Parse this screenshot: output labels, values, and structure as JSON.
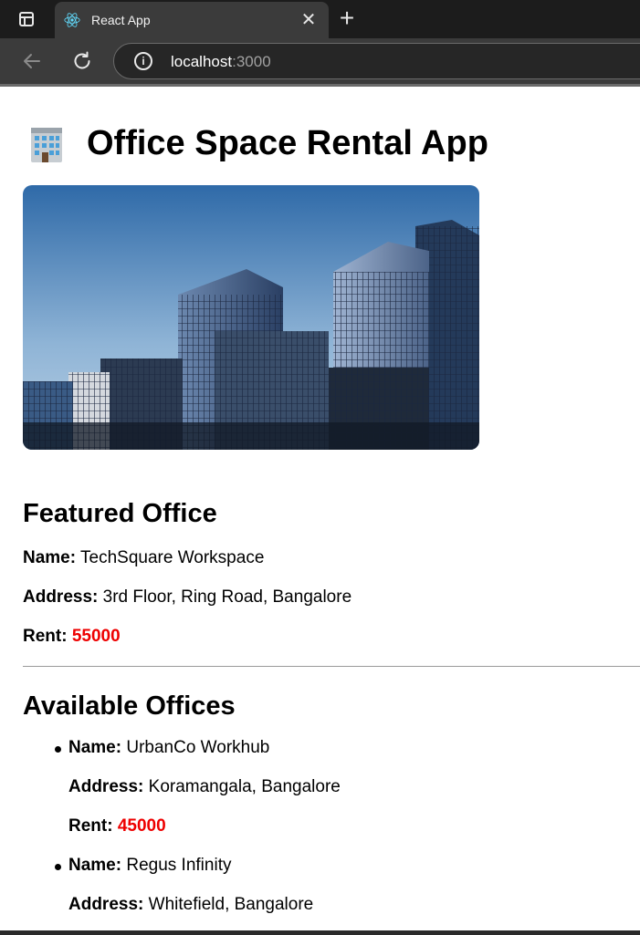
{
  "browser": {
    "tab_title": "React App",
    "tab_close": "✕",
    "new_tab": "+",
    "url_host": "localhost",
    "url_port": ":3000",
    "info_icon": "i"
  },
  "page": {
    "title": "Office Space Rental App",
    "title_icon": "office-building-emoji",
    "featured": {
      "heading": "Featured Office",
      "name_label": "Name:",
      "name": "TechSquare Workspace",
      "address_label": "Address:",
      "address": "3rd Floor, Ring Road, Bangalore",
      "rent_label": "Rent:",
      "rent": "55000"
    },
    "available": {
      "heading": "Available Offices",
      "offices": [
        {
          "name_label": "Name:",
          "name": "UrbanCo Workhub",
          "address_label": "Address:",
          "address": "Koramangala, Bangalore",
          "rent_label": "Rent:",
          "rent": "45000"
        },
        {
          "name_label": "Name:",
          "name": "Regus Infinity",
          "address_label": "Address:",
          "address": "Whitefield, Bangalore"
        }
      ]
    },
    "rent_color": "#ee0000"
  }
}
